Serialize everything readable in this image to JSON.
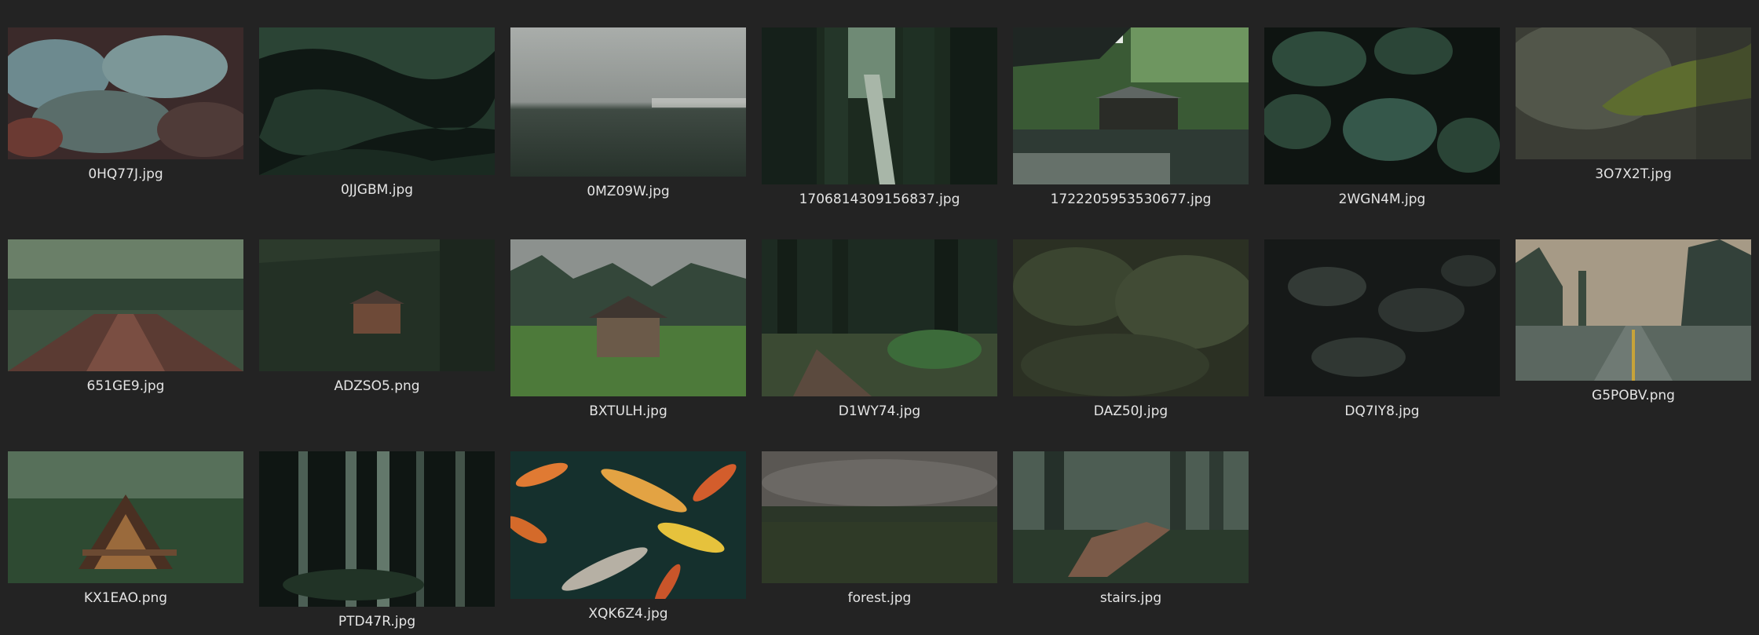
{
  "files": [
    {
      "name": "0HQ77J.jpg",
      "icon": "image-thumbnail",
      "depicts": "frosty evergreen shrubs"
    },
    {
      "name": "0JJGBM.jpg",
      "icon": "image-thumbnail",
      "depicts": "dark fern leaves"
    },
    {
      "name": "0MZ09W.jpg",
      "icon": "image-thumbnail",
      "depicts": "foggy grass field"
    },
    {
      "name": "1706814309156837.jpg",
      "icon": "image-thumbnail",
      "depicts": "forest gorge waterfall"
    },
    {
      "name": "1722205953530677.jpg",
      "icon": "image-thumbnail",
      "depicts": "japanese garden pond"
    },
    {
      "name": "2WGN4M.jpg",
      "icon": "image-thumbnail",
      "depicts": "monstera leaves"
    },
    {
      "name": "3O7X2T.jpg",
      "icon": "image-thumbnail",
      "depicts": "mossy branch"
    },
    {
      "name": "651GE9.jpg",
      "icon": "image-thumbnail",
      "depicts": "rail bridge in forest"
    },
    {
      "name": "ADZSO5.png",
      "icon": "image-thumbnail",
      "depicts": "cabin in dark forest"
    },
    {
      "name": "BXTULH.jpg",
      "icon": "image-thumbnail",
      "depicts": "wooden hut in foggy meadow"
    },
    {
      "name": "D1WY74.jpg",
      "icon": "image-thumbnail",
      "depicts": "forest path with ferns"
    },
    {
      "name": "DAZ50J.jpg",
      "icon": "image-thumbnail",
      "depicts": "dense dark foliage"
    },
    {
      "name": "DQ7IY8.jpg",
      "icon": "image-thumbnail",
      "depicts": "dark leaves"
    },
    {
      "name": "G5POBV.png",
      "icon": "image-thumbnail",
      "depicts": "wet road through pines"
    },
    {
      "name": "KX1EAO.png",
      "icon": "image-thumbnail",
      "depicts": "a-frame cabin in forest"
    },
    {
      "name": "PTD47R.jpg",
      "icon": "image-thumbnail",
      "depicts": "bamboo forest"
    },
    {
      "name": "XQK6Z4.jpg",
      "icon": "image-thumbnail",
      "depicts": "koi fish pond"
    },
    {
      "name": "forest.jpg",
      "icon": "image-thumbnail",
      "depicts": "misty forest aerial"
    },
    {
      "name": "stairs.jpg",
      "icon": "image-thumbnail",
      "depicts": "wooden stairs in forest"
    }
  ]
}
